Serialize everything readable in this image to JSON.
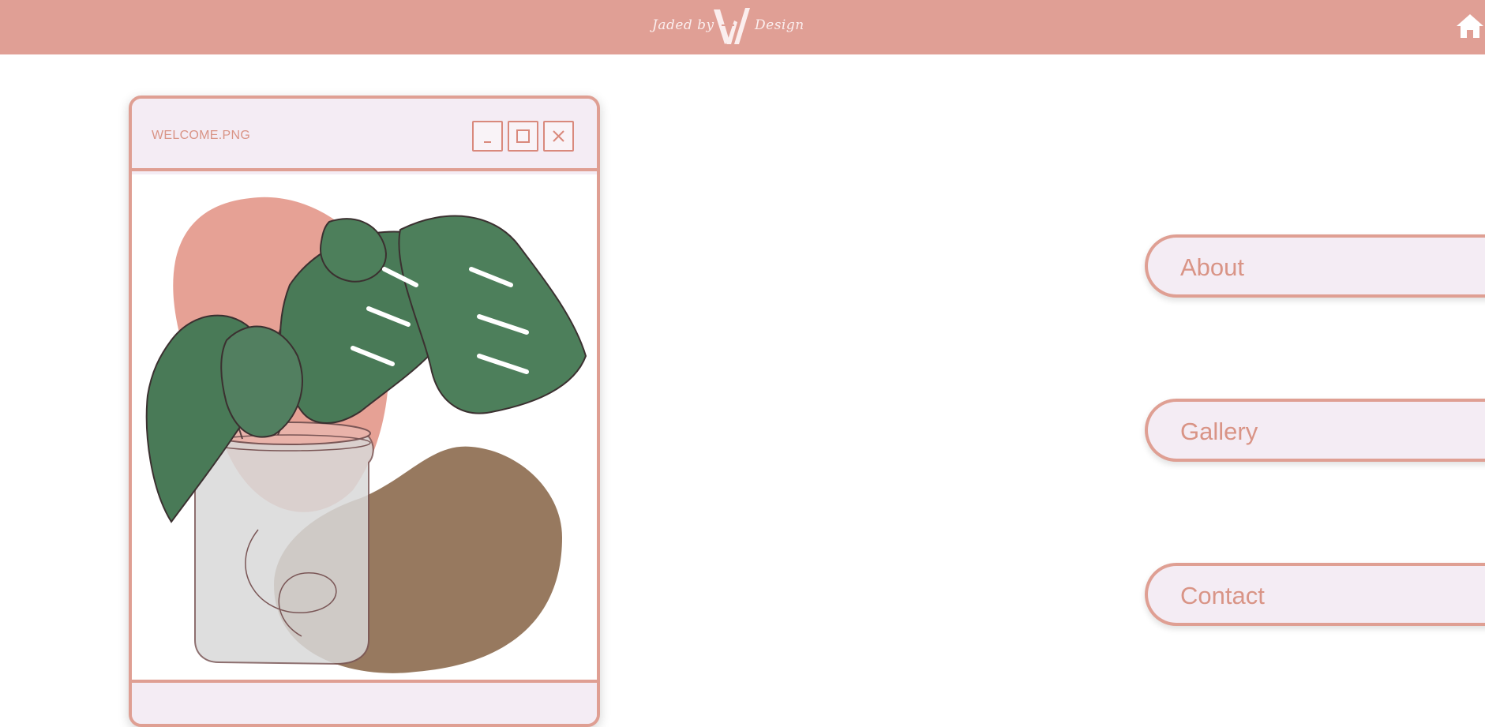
{
  "header": {
    "logo_left": "Jaded by",
    "logo_right": "Design",
    "home_icon": "home-icon",
    "background": "#e09f95"
  },
  "window": {
    "title": "WELCOME.PNG",
    "buttons": {
      "minimize_icon": "minimize-icon",
      "maximize_icon": "maximize-icon",
      "close_icon": "close-icon"
    },
    "border_color": "#df9f93"
  },
  "nav": {
    "items": [
      {
        "label": "About"
      },
      {
        "label": "Gallery"
      },
      {
        "label": "Contact"
      }
    ]
  },
  "colors": {
    "accent": "#df9f93",
    "text": "#d99486",
    "panel": "#f4ecf4"
  }
}
